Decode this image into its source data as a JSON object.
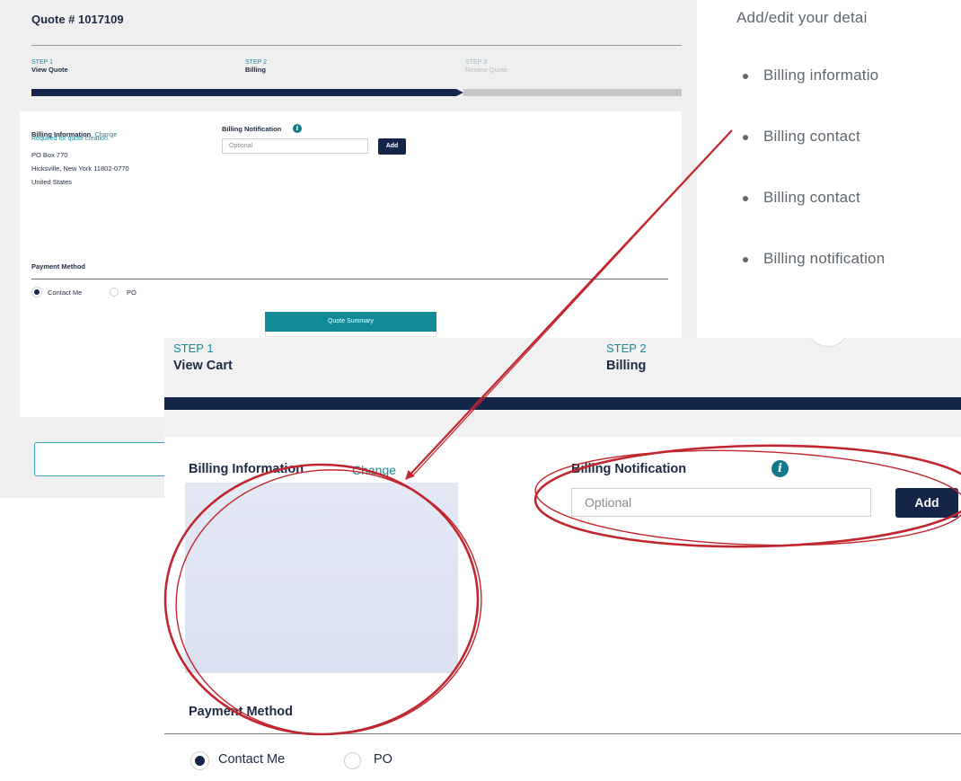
{
  "background_screenshot": {
    "quote_title": "Quote # 1017109",
    "steps": [
      {
        "number": "STEP 1",
        "name": "View Quote"
      },
      {
        "number": "STEP 2",
        "name": "Billing"
      },
      {
        "number": "STEP 3",
        "name": "Review Quote"
      }
    ],
    "billing_info_label": "Billing Information",
    "billing_change_link": "Change",
    "billing_required_note": "Required for quote creation.",
    "address_line1": "PO Box 770",
    "address_line2": "Hicksville, New York 11802-0770",
    "address_line3": "United States",
    "billing_notification_label": "Billing Notification",
    "notification_placeholder": "Optional",
    "add_button": "Add",
    "payment_method_label": "Payment Method",
    "payment_options": [
      "Contact Me",
      "PO"
    ],
    "quote_summary_label": "Quote Summary"
  },
  "notes": {
    "intro": "Add/edit your detai",
    "items": [
      "Billing informatio",
      "Billing contact",
      "Billing contact",
      "Billing notification"
    ]
  },
  "zoomed": {
    "steps": [
      {
        "number": "STEP 1",
        "name": "View Cart"
      },
      {
        "number": "STEP 2",
        "name": "Billing"
      }
    ],
    "billing_info_label": "Billing Information",
    "billing_change_link": "Change",
    "billing_notification_label": "Billing Notification",
    "notification_placeholder": "Optional",
    "add_button": "Add",
    "payment_method_label": "Payment Method",
    "payment_options": [
      "Contact Me",
      "PO"
    ]
  },
  "info_icon_glyph": "i",
  "colors": {
    "navy": "#14254a",
    "teal": "#1a8a9a",
    "annotation_red": "#c0262e"
  }
}
